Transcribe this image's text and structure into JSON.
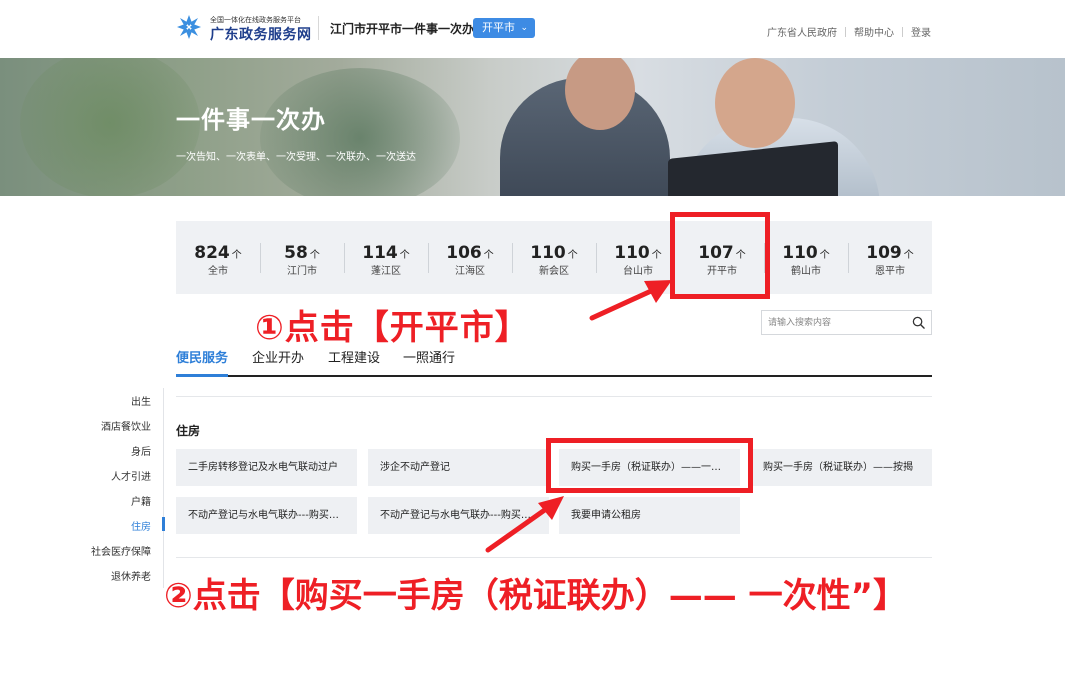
{
  "header": {
    "logo_subtitle": "全国一体化在线政务服务平台",
    "logo_title": "广东政务服务网",
    "site_title": "江门市开平市一件事一次办",
    "city_selector": "开平市",
    "links": [
      "广东省人民政府",
      "帮助中心",
      "登录"
    ]
  },
  "banner": {
    "title": "一件事一次办",
    "subtitle": "一次告知、一次表单、一次受理、一次联办、一次送达"
  },
  "stats": {
    "unit": "个",
    "items": [
      {
        "count": "824",
        "name": "全市"
      },
      {
        "count": "58",
        "name": "江门市"
      },
      {
        "count": "114",
        "name": "蓬江区"
      },
      {
        "count": "106",
        "name": "江海区"
      },
      {
        "count": "110",
        "name": "新会区"
      },
      {
        "count": "110",
        "name": "台山市"
      },
      {
        "count": "107",
        "name": "开平市"
      },
      {
        "count": "110",
        "name": "鹤山市"
      },
      {
        "count": "109",
        "name": "恩平市"
      }
    ]
  },
  "annotations": {
    "step1": "①点击【开平市】",
    "step2": "②点击【购买一手房（税证联办）—— 一次性”】"
  },
  "search": {
    "placeholder": "请输入搜索内容",
    "value": ""
  },
  "tabs": [
    "便民服务",
    "企业开办",
    "工程建设",
    "一照通行"
  ],
  "sidenav": [
    "出生",
    "酒店餐饮业",
    "身后",
    "人才引进",
    "户籍",
    "住房",
    "社会医疗保障",
    "退休养老"
  ],
  "section": {
    "title": "住房",
    "cards": [
      "二手房转移登记及水电气联动过户",
      "涉企不动产登记",
      "购买一手房（税证联办）——一…",
      "购买一手房（税证联办）——按揭",
      "不动产登记与水电气联办---购买…",
      "不动产登记与水电气联办---购买…",
      "我要申请公租房"
    ]
  },
  "colors": {
    "accent": "#2e7fd8",
    "annotation_red": "#ee1f25",
    "city_select_bg": "#3d8be4"
  }
}
